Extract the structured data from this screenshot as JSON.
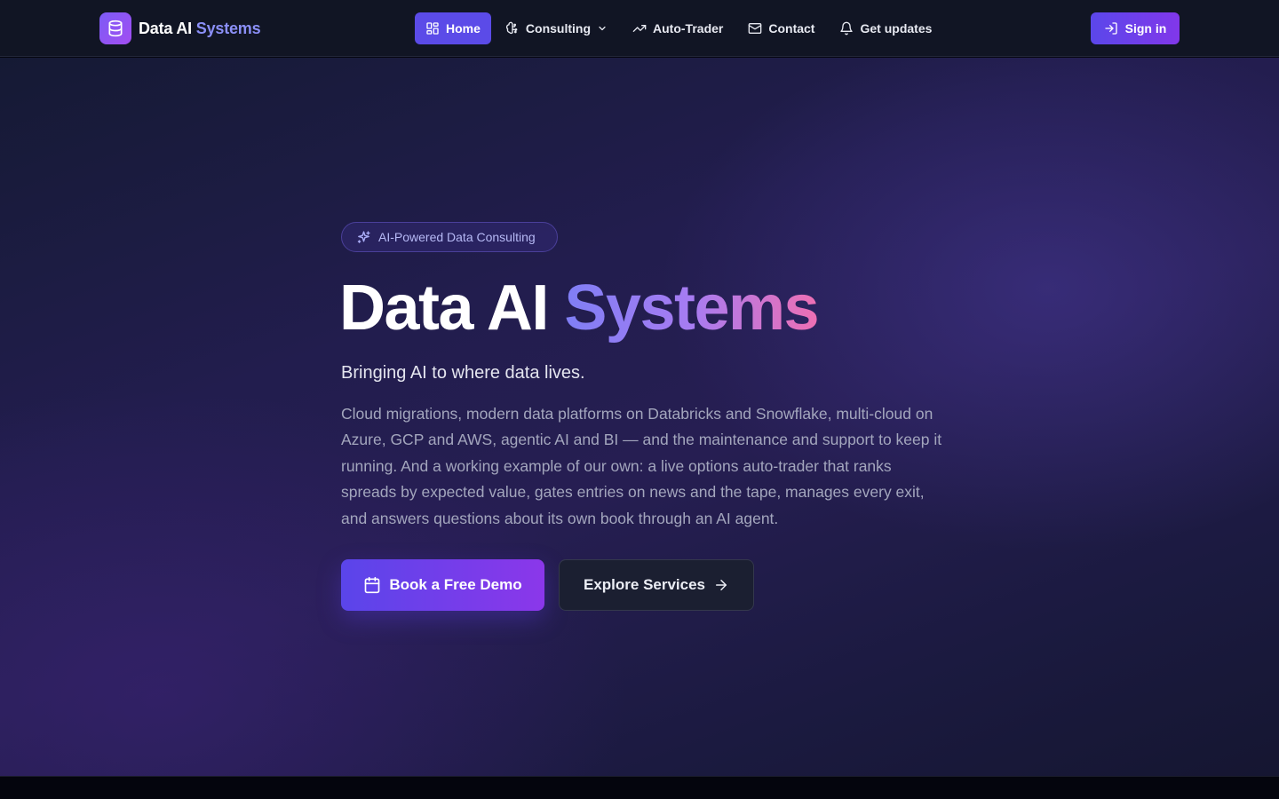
{
  "brand": {
    "name_part1": "Data AI",
    "name_part2": "Systems",
    "logo_icon": "database-icon"
  },
  "nav": {
    "items": [
      {
        "label": "Home",
        "icon": "grid-icon",
        "active": true
      },
      {
        "label": "Consulting",
        "icon": "brain-icon",
        "has_dropdown": true
      },
      {
        "label": "Auto-Trader",
        "icon": "trending-up-icon"
      },
      {
        "label": "Contact",
        "icon": "mail-icon"
      },
      {
        "label": "Get updates",
        "icon": "bell-icon"
      }
    ],
    "signin_label": "Sign in"
  },
  "hero": {
    "badge": "AI-Powered Data Consulting",
    "title_part1": "Data AI",
    "title_part2": "Systems",
    "tagline": "Bringing AI to where data lives.",
    "description": "Cloud migrations, modern data platforms on Databricks and Snowflake, multi-cloud on Azure, GCP and AWS, agentic AI and BI — and the maintenance and support to keep it running. And a working example of our own: a live options auto-trader that ranks spreads by expected value, gates entries on news and the tape, manages every exit, and answers questions about its own book through an AI agent.",
    "primary_cta": "Book a Free Demo",
    "secondary_cta": "Explore Services"
  },
  "colors": {
    "accent": "#5b4be8",
    "accent_end": "#8b37ea",
    "navbar_bg": "#111524",
    "title_gradient_start": "#7f7ef5",
    "title_gradient_end": "#ee6fb3"
  }
}
